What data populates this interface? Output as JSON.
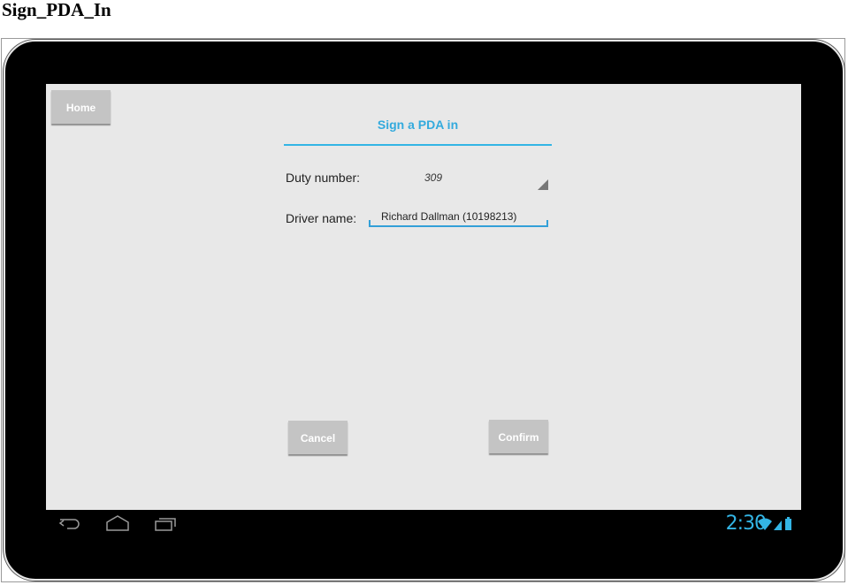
{
  "page": {
    "title": "Sign_PDA_In"
  },
  "app": {
    "home_label": "Home",
    "dialog_title": "Sign a PDA in",
    "duty": {
      "label": "Duty number:",
      "value": "309"
    },
    "driver": {
      "label": "Driver name:",
      "value": "Richard Dallman (10198213)"
    },
    "cancel_label": "Cancel",
    "confirm_label": "Confirm"
  },
  "navbar": {
    "icons": [
      "back-icon",
      "home-icon",
      "recent-apps-icon"
    ],
    "time": "2:30",
    "status_icons": [
      "wifi-icon",
      "signal-icon",
      "battery-icon"
    ]
  },
  "colors": {
    "accent": "#33b5e5",
    "button": "#c4c4c4",
    "screen": "#e8e8e8"
  }
}
